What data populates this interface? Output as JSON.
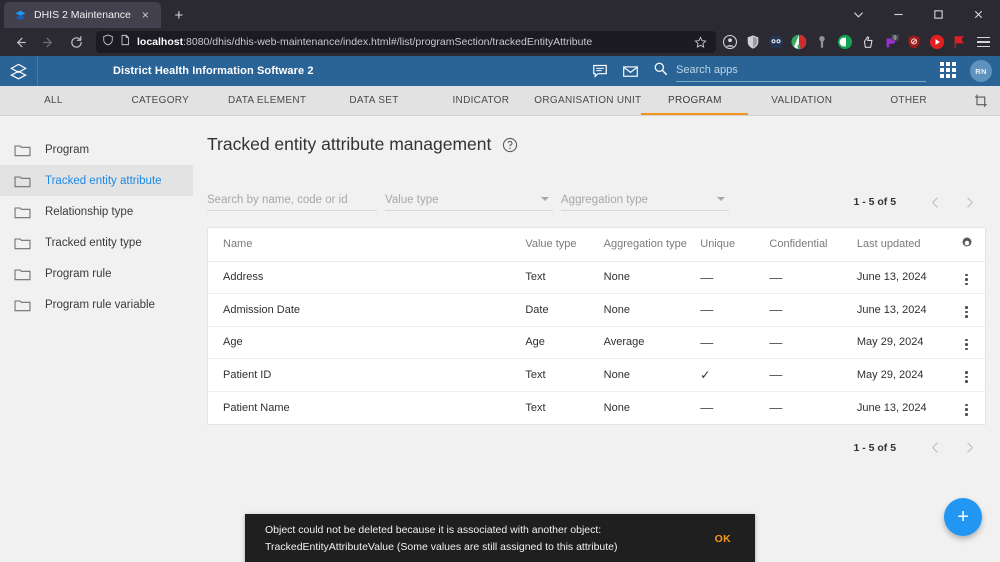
{
  "browser": {
    "tab": {
      "title": "DHIS 2 Maintenance",
      "favicon": "dhis2-logo-icon",
      "close": "×"
    },
    "new_tab_label": "+",
    "window_controls": [
      {
        "name": "list-all-tabs-icon",
        "glyph": "⌄"
      },
      {
        "name": "minimize-icon",
        "glyph": "−"
      },
      {
        "name": "maximize-icon",
        "glyph": "□"
      },
      {
        "name": "close-window-icon",
        "glyph": "✕"
      }
    ],
    "nav": {
      "back": "←",
      "forward": "→",
      "reload": "⟳"
    },
    "url": {
      "host": "localhost",
      "path": ":8080/dhis/dhis-web-maintenance/index.html#/list/programSection/trackedEntityAttribute",
      "full": "localhost:8080/dhis/dhis-web-maintenance/index.html#/list/programSection/trackedEntityAttribute",
      "shield_icon": "shield-icon",
      "page_icon": "page-icon",
      "bookmark_icon": "star-icon"
    },
    "extensions": [
      {
        "name": "account-icon",
        "color": "#d7d7de"
      },
      {
        "name": "shield-extension-icon",
        "color": "#cfcfd8"
      },
      {
        "name": "dark-reader-icon",
        "color": "#2f4f7f"
      },
      {
        "name": "colorzilla-icon",
        "color": "#d23c3c"
      },
      {
        "name": "keepassxc-icon",
        "color": "#8f8f96"
      },
      {
        "name": "privacy-badger-icon",
        "color": "#12a150"
      },
      {
        "name": "ublock-thumb-icon",
        "color": "#d6d6de"
      },
      {
        "name": "purple-extension-icon",
        "color": "#9b2fd0",
        "badge": "0"
      },
      {
        "name": "ublock-origin-icon",
        "color": "#9b1c1c"
      },
      {
        "name": "youtube-extension-icon",
        "color": "#e02020"
      },
      {
        "name": "flag-extension-icon",
        "color": "#e02020"
      }
    ],
    "menu_icon": "hamburger-menu-icon"
  },
  "header": {
    "logo_icon": "dhis2-layers-logo-icon",
    "title": "District Health Information Software 2",
    "icons": [
      {
        "name": "messages-icon",
        "glyph": "message"
      },
      {
        "name": "email-icon",
        "glyph": "envelope"
      }
    ],
    "search": {
      "icon": "search-icon",
      "placeholder": "Search apps",
      "value": ""
    },
    "apps_icon": "apps-grid-icon",
    "avatar_initials": "RN",
    "brand_color": "#2a6496"
  },
  "section_tabs": {
    "items": [
      {
        "label": "ALL",
        "active": false
      },
      {
        "label": "CATEGORY",
        "active": false
      },
      {
        "label": "DATA ELEMENT",
        "active": false
      },
      {
        "label": "DATA SET",
        "active": false
      },
      {
        "label": "INDICATOR",
        "active": false
      },
      {
        "label": "ORGANISATION UNIT",
        "active": false
      },
      {
        "label": "PROGRAM",
        "active": true
      },
      {
        "label": "VALIDATION",
        "active": false
      },
      {
        "label": "OTHER",
        "active": false
      }
    ],
    "expand_icon": "crop-expand-icon",
    "active_underline_color": "#f7941e"
  },
  "sidebar": {
    "items": [
      {
        "label": "Program",
        "selected": false,
        "icon": "folder-icon"
      },
      {
        "label": "Tracked entity attribute",
        "selected": true,
        "icon": "folder-icon"
      },
      {
        "label": "Relationship type",
        "selected": false,
        "icon": "folder-icon"
      },
      {
        "label": "Tracked entity type",
        "selected": false,
        "icon": "folder-icon"
      },
      {
        "label": "Program rule",
        "selected": false,
        "icon": "folder-icon"
      },
      {
        "label": "Program rule variable",
        "selected": false,
        "icon": "folder-icon"
      }
    ],
    "selected_color": "#1e88e5"
  },
  "main": {
    "page_title": "Tracked entity attribute management",
    "help_icon": "help-circle-icon",
    "filters": {
      "search_placeholder": "Search by name, code or id",
      "search_value": "",
      "value_type_placeholder": "Value type",
      "value_type_value": "",
      "aggregation_type_placeholder": "Aggregation type",
      "aggregation_type_value": ""
    },
    "pagination": {
      "count_text": "1 - 5 of 5",
      "prev_icon": "chevron-left-icon",
      "next_icon": "chevron-right-icon"
    },
    "table": {
      "columns": [
        "Name",
        "Value type",
        "Aggregation type",
        "Unique",
        "Confidential",
        "Last updated"
      ],
      "settings_icon": "gear-icon",
      "rows": [
        {
          "name": "Address",
          "value_type": "Value type: Text",
          "value_type_display": "Text",
          "aggregation_type": "None",
          "unique": "—",
          "confidential": "—",
          "last_updated": "June 13, 2024",
          "actions_icon": "kebab-menu-icon"
        },
        {
          "name": "Admission Date",
          "value_type_display": "Date",
          "aggregation_type": "None",
          "unique": "—",
          "confidential": "—",
          "last_updated": "June 13, 2024",
          "actions_icon": "kebab-menu-icon"
        },
        {
          "name": "Age",
          "value_type_display": "Age",
          "aggregation_type": "Average",
          "unique": "—",
          "confidential": "—",
          "last_updated": "May 29, 2024",
          "actions_icon": "kebab-menu-icon"
        },
        {
          "name": "Patient ID",
          "value_type_display": "Text",
          "aggregation_type": "None",
          "unique": "✓",
          "confidential": "—",
          "last_updated": "May 29, 2024",
          "actions_icon": "kebab-menu-icon"
        },
        {
          "name": "Patient Name",
          "value_type_display": "Text",
          "aggregation_type": "None",
          "unique": "—",
          "confidential": "—",
          "last_updated": "June 13, 2024",
          "actions_icon": "kebab-menu-icon"
        }
      ]
    },
    "fab": {
      "label": "+",
      "icon": "plus-icon",
      "color": "#2196f3"
    }
  },
  "snackbar": {
    "line1": "Object could not be deleted because it is associated with another object:",
    "line2": "TrackedEntityAttributeValue (Some values are still assigned to this attribute)",
    "action_label": "OK",
    "action_color": "#f79a1e",
    "background": "#1f1f1f"
  }
}
